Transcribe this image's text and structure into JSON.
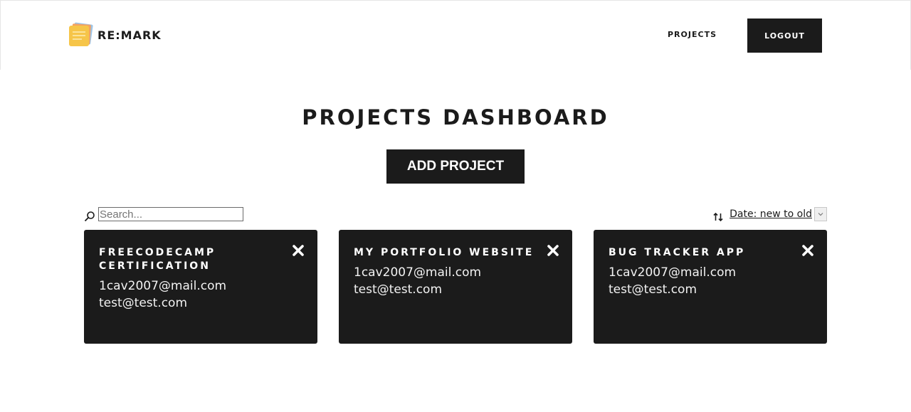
{
  "header": {
    "brand": "RE:MARK",
    "nav_projects": "PROJECTS",
    "logout": "LOGOUT"
  },
  "main": {
    "title": "PROJECTS DASHBOARD",
    "add_project": "ADD PROJECT",
    "search": {
      "placeholder": "Search...",
      "value": ""
    },
    "sort": {
      "selected": "Date: new to old"
    }
  },
  "projects": [
    {
      "title": "FREECODECAMP CERTIFICATION",
      "members": [
        "1cav2007@mail.com",
        "test@test.com"
      ]
    },
    {
      "title": "MY PORTFOLIO WEBSITE",
      "members": [
        "1cav2007@mail.com",
        "test@test.com"
      ]
    },
    {
      "title": "BUG TRACKER APP",
      "members": [
        "1cav2007@mail.com",
        "test@test.com"
      ]
    }
  ],
  "icons": {
    "logo": "sticky-notes-logo",
    "search": "magnifier-icon",
    "sort": "sort-arrows-icon",
    "close": "close-x-icon",
    "dropdown": "chevron-down-icon"
  },
  "colors": {
    "dark": "#1b1b1b",
    "background": "#ffffff",
    "logo_yellow": "#f6c549"
  }
}
